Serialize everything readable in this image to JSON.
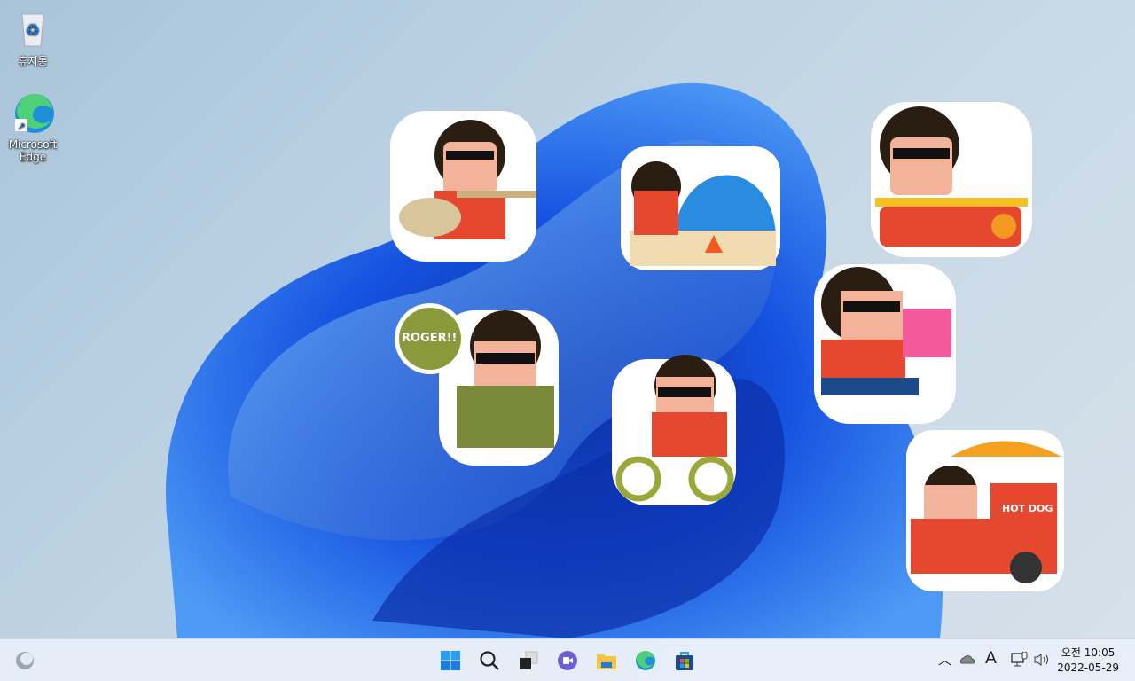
{
  "desktop": {
    "icons": [
      {
        "label": "휴지통",
        "icon": "recycle-bin-icon"
      },
      {
        "label": "Microsoft Edge",
        "icon": "edge-icon"
      }
    ],
    "stickers": [
      {
        "name": "guitar-sticker"
      },
      {
        "name": "camping-sticker"
      },
      {
        "name": "bathtub-sticker"
      },
      {
        "name": "roger-soldier-sticker",
        "text": "ROGER!!"
      },
      {
        "name": "bicycle-sticker"
      },
      {
        "name": "gift-sticker"
      },
      {
        "name": "hotdog-cart-sticker",
        "text": "HOT DOG"
      }
    ]
  },
  "taskbar": {
    "left": "widgets-icon",
    "center": [
      "start-icon",
      "search-icon",
      "task-view-icon",
      "teams-chat-icon",
      "file-explorer-icon",
      "edge-icon",
      "store-icon"
    ],
    "tray": {
      "icons": [
        "chevron-up-icon",
        "onedrive-icon",
        "ime-icon",
        "network-icon",
        "volume-icon"
      ],
      "ime_label": "A"
    },
    "clock": {
      "time": "오전 10:05",
      "date": "2022-05-29"
    }
  },
  "colors": {
    "accent": "#1a5fe0",
    "taskbar": "#e8eef8"
  }
}
